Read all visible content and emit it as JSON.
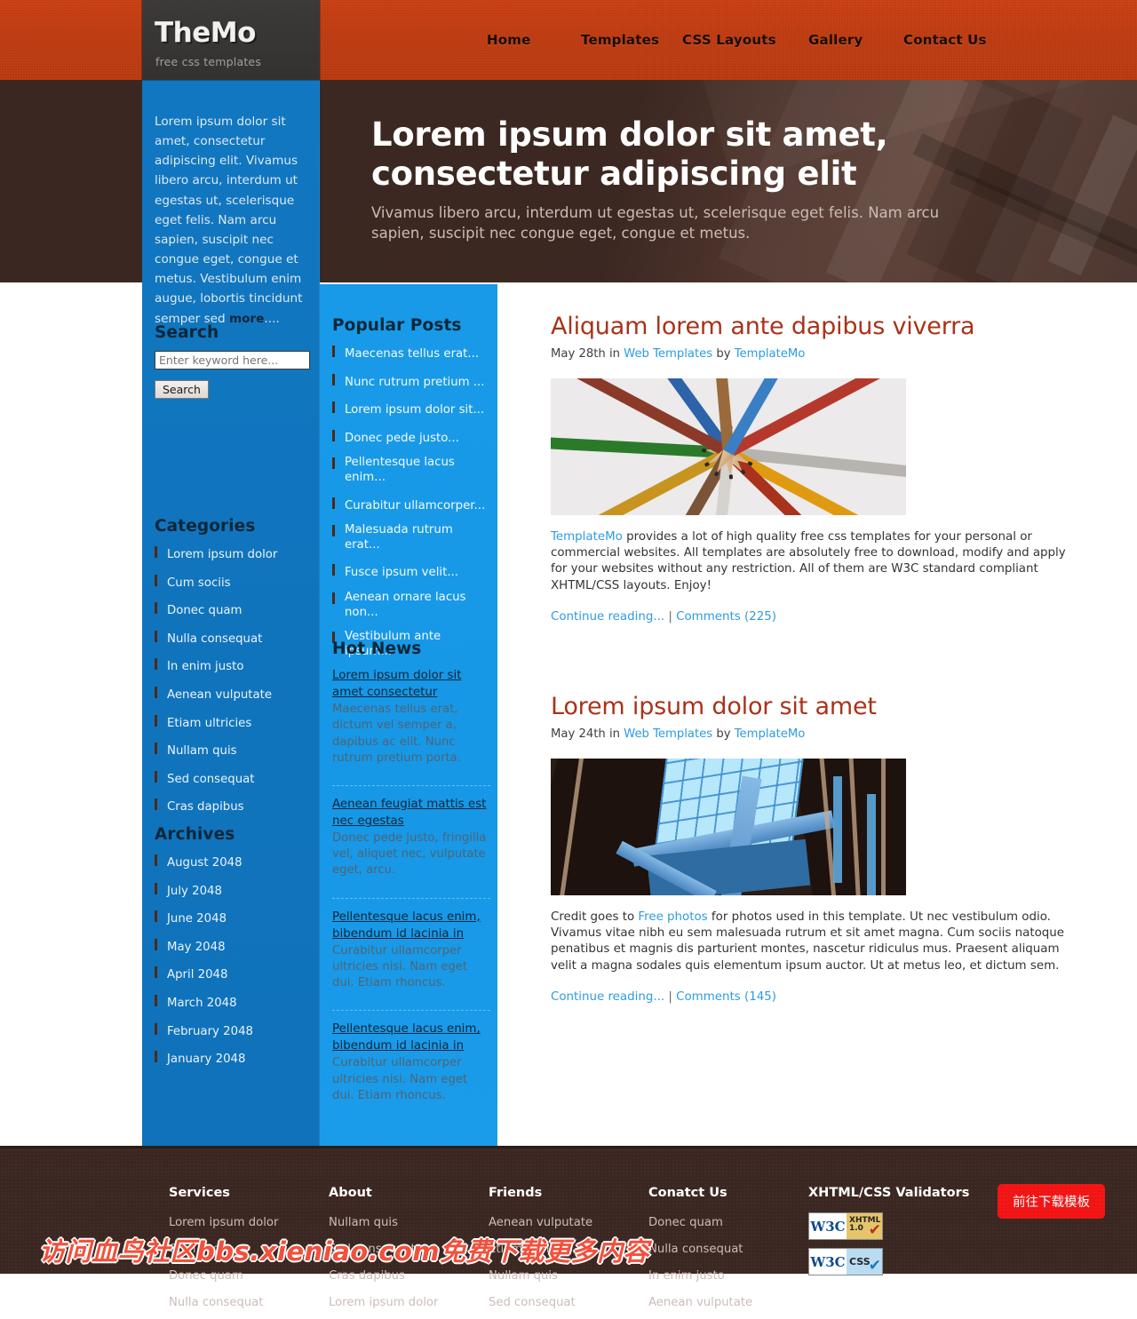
{
  "header": {
    "logo_title": "TheMo",
    "logo_subtitle": "free css templates",
    "nav": [
      {
        "label": "Home"
      },
      {
        "label": "Templates"
      },
      {
        "label": "CSS Layouts"
      },
      {
        "label": "Gallery"
      },
      {
        "label": "Contact Us"
      }
    ]
  },
  "hero": {
    "heading": "Lorem ipsum dolor sit amet, consectetur adipiscing elit",
    "paragraph": "Vivamus libero arcu, interdum ut egestas ut, scelerisque eget felis. Nam arcu sapien, suscipit nec congue eget, congue et metus."
  },
  "sidebar_left": {
    "intro_text": "Lorem ipsum dolor sit amet, consectetur adipiscing elit. Vivamus libero arcu, interdum ut egestas ut, scelerisque eget felis. Nam arcu sapien, suscipit nec congue eget, congue et metus. Vestibulum enim augue, lobortis tincidunt semper sed ",
    "intro_more": "more",
    "intro_tail": "....",
    "search": {
      "title": "Search",
      "placeholder": "Enter keyword here...",
      "value": "",
      "button_label": "Search"
    },
    "categories": {
      "title": "Categories",
      "items": [
        {
          "label": "Lorem ipsum dolor"
        },
        {
          "label": "Cum sociis"
        },
        {
          "label": "Donec quam"
        },
        {
          "label": "Nulla consequat"
        },
        {
          "label": "In enim justo"
        },
        {
          "label": "Aenean vulputate"
        },
        {
          "label": "Etiam ultricies"
        },
        {
          "label": "Nullam quis"
        },
        {
          "label": "Sed consequat"
        },
        {
          "label": "Cras dapibus"
        }
      ]
    },
    "archives": {
      "title": "Archives",
      "items": [
        {
          "label": "August 2048"
        },
        {
          "label": "July 2048"
        },
        {
          "label": "June 2048"
        },
        {
          "label": "May 2048"
        },
        {
          "label": "April 2048"
        },
        {
          "label": "March 2048"
        },
        {
          "label": "February 2048"
        },
        {
          "label": "January 2048"
        }
      ]
    }
  },
  "sidebar_mid": {
    "popular_posts": {
      "title": "Popular Posts",
      "items": [
        {
          "label": "Maecenas tellus erat..."
        },
        {
          "label": "Nunc rutrum pretium ..."
        },
        {
          "label": "Lorem ipsum dolor sit..."
        },
        {
          "label": "Donec pede justo..."
        },
        {
          "label": "Pellentesque lacus enim..."
        },
        {
          "label": "Curabitur ullamcorper..."
        },
        {
          "label": "Malesuada rutrum erat..."
        },
        {
          "label": "Fusce ipsum velit..."
        },
        {
          "label": "Aenean ornare lacus non..."
        },
        {
          "label": "Vestibulum ante ipsum..."
        }
      ]
    },
    "hot_news": {
      "title": "Hot News",
      "items": [
        {
          "title": "Lorem ipsum dolor sit amet consectetur",
          "text": "Maecenas tellus erat, dictum vel semper a, dapibus ac elit. Nunc rutrum pretium porta."
        },
        {
          "title": "Aenean feugiat mattis est nec egestas",
          "text": "Donec pede justo, fringilla vel, aliquet nec, vulputate eget, arcu."
        },
        {
          "title": "Pellentesque lacus enim, bibendum id lacinia in",
          "text": "Curabitur ullamcorper ultricies nisi. Nam eget dui. Etiam rhoncus."
        },
        {
          "title": "Pellentesque lacus enim, bibendum id lacinia in",
          "text": "Curabitur ullamcorper ultricies nisi. Nam eget dui. Etiam rhoncus."
        }
      ]
    }
  },
  "main": {
    "posts": [
      {
        "title": "Aliquam lorem ante dapibus viverra",
        "meta_date": "May 28th in ",
        "meta_category": "Web Templates",
        "meta_by": " by ",
        "meta_author": "TemplateMo",
        "image_name": "colored-pencils-photo",
        "body_link": "TemplateMo",
        "body_text": " provides a lot of high quality free css templates for your personal or commercial websites. All templates are absolutely free to download, modify and apply for your websites without any restriction. All of them are W3C standard compliant XHTML/CSS layouts. Enjoy!",
        "continue_label": "Continue reading...",
        "separator": " | ",
        "comments_label": "Comments (225)"
      },
      {
        "title": "Lorem ipsum dolor sit amet",
        "meta_date": "May 24th in ",
        "meta_category": "Web Templates",
        "meta_by": " by ",
        "meta_author": "TemplateMo",
        "image_name": "blue-architecture-photo",
        "body_prefix": "Credit goes to ",
        "body_link": "Free photos",
        "body_text": " for photos used in this template. Ut nec vestibulum odio. Vivamus vitae nibh eu sem malesuada rutrum et sit amet magna. Cum sociis natoque penatibus et magnis dis parturient montes, nascetur ridiculus mus. Praesent aliquam velit a magna sodales quis elementum ipsum auctor. Ut at metus leo, et dictum sem.",
        "continue_label": "Continue reading...",
        "separator": " | ",
        "comments_label": "Comments (145)"
      }
    ]
  },
  "footer": {
    "columns": [
      {
        "title": "Services",
        "items": [
          {
            "label": "Lorem ipsum dolor"
          },
          {
            "label": "Cum sociis"
          },
          {
            "label": "Donec quam"
          },
          {
            "label": "Nulla consequat"
          }
        ]
      },
      {
        "title": "About",
        "items": [
          {
            "label": "Nullam quis"
          },
          {
            "label": "Sed consequat"
          },
          {
            "label": "Cras dapibus"
          },
          {
            "label": "Lorem ipsum dolor"
          }
        ]
      },
      {
        "title": "Friends",
        "items": [
          {
            "label": "Aenean vulputate"
          },
          {
            "label": "Etiam ultricies"
          },
          {
            "label": "Nullam quis"
          },
          {
            "label": "Sed consequat"
          }
        ]
      },
      {
        "title": "Conatct Us",
        "items": [
          {
            "label": "Donec quam"
          },
          {
            "label": "Nulla consequat"
          },
          {
            "label": "In enim justo"
          },
          {
            "label": "Aenean vulputate"
          }
        ]
      }
    ],
    "validators": {
      "title": "XHTML/CSS Validators",
      "xhtml_badge": {
        "w3c": "W3C",
        "label": "XHTML 1.0",
        "tick": "✔"
      },
      "css_badge": {
        "w3c": "W3C",
        "label": "CSS",
        "tick": "✔"
      }
    },
    "download_button": "前往下载模板"
  },
  "watermark": {
    "text": "访问血鸟社区bbs.xieniao.com免费下载更多内容"
  }
}
